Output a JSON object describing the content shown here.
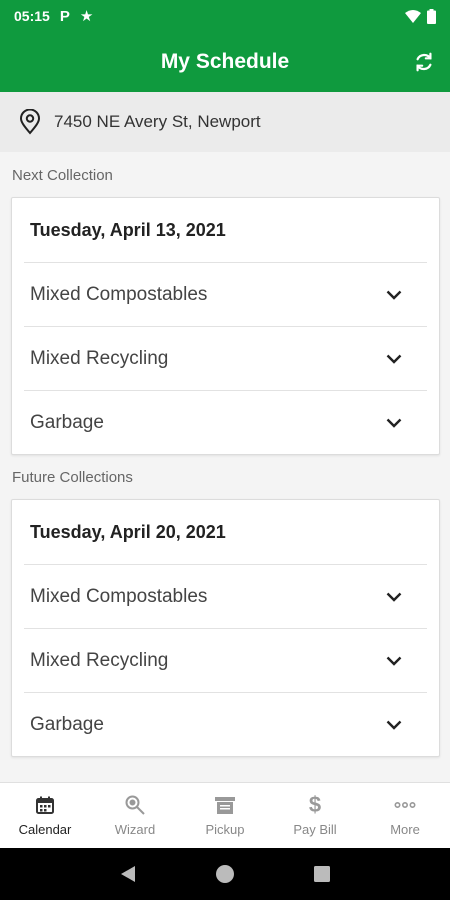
{
  "status": {
    "time": "05:15"
  },
  "header": {
    "title": "My Schedule"
  },
  "location": {
    "address": "7450 NE Avery St, Newport"
  },
  "next": {
    "label": "Next Collection",
    "date": "Tuesday, April 13, 2021",
    "items": [
      "Mixed Compostables",
      "Mixed Recycling",
      "Garbage"
    ]
  },
  "future": {
    "label": "Future Collections",
    "date": "Tuesday, April 20, 2021",
    "items": [
      "Mixed Compostables",
      "Mixed Recycling",
      "Garbage"
    ]
  },
  "nav": {
    "items": [
      {
        "label": "Calendar",
        "icon": "calendar-icon"
      },
      {
        "label": "Wizard",
        "icon": "wizard-icon"
      },
      {
        "label": "Pickup",
        "icon": "pickup-icon"
      },
      {
        "label": "Pay Bill",
        "icon": "dollar-icon"
      },
      {
        "label": "More",
        "icon": "more-icon"
      }
    ]
  },
  "colors": {
    "brand": "#0f9a3e"
  }
}
